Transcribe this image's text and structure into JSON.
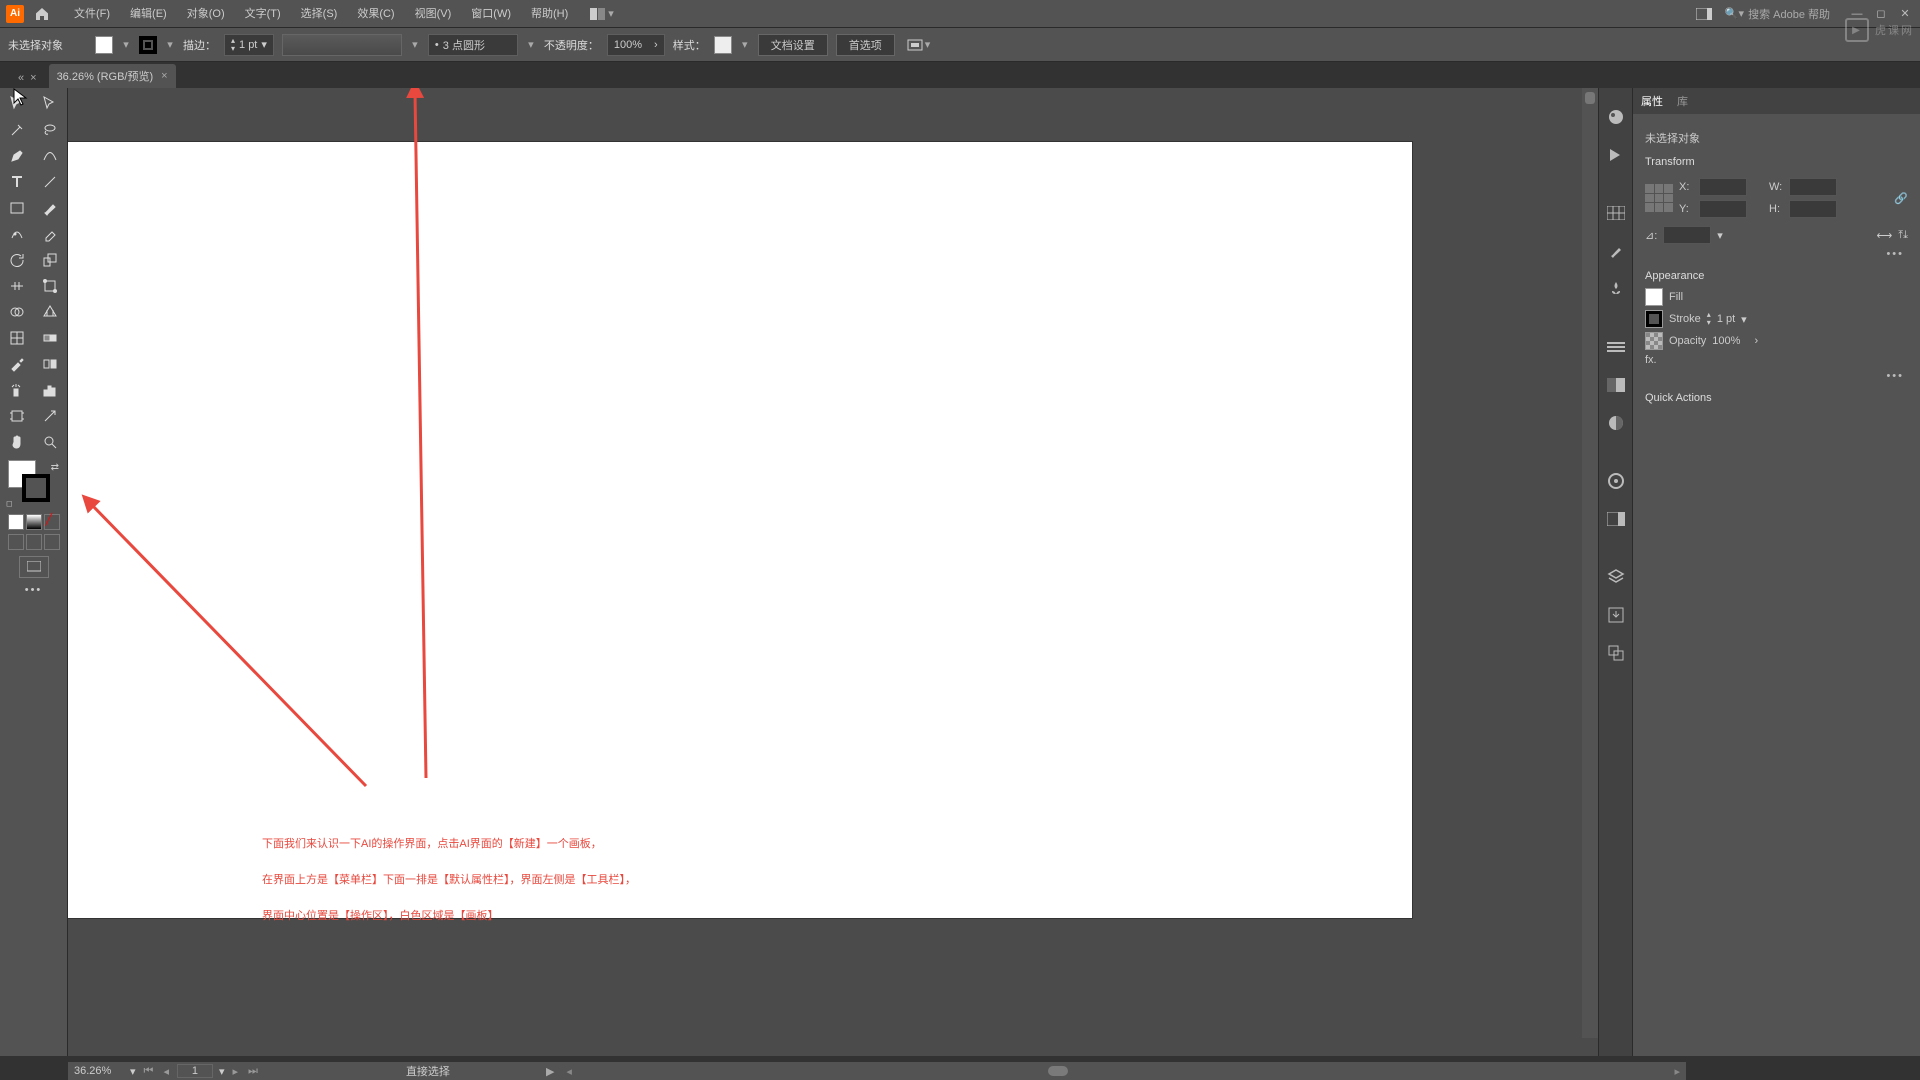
{
  "menu": {
    "items": [
      "文件(F)",
      "编辑(E)",
      "对象(O)",
      "文字(T)",
      "选择(S)",
      "效果(C)",
      "视图(V)",
      "窗口(W)",
      "帮助(H)"
    ],
    "search_placeholder": "搜索 Adobe 帮助"
  },
  "propbar": {
    "no_selection": "未选择对象",
    "stroke_label": "描边：",
    "stroke_value": "1 pt",
    "brush_value": "3 点圆形",
    "brush_bullet": "•",
    "opacity_label": "不透明度：",
    "opacity_value": "100%",
    "style_label": "样式：",
    "doc_setup": "文档设置",
    "prefs": "首选项"
  },
  "tab": {
    "title": "36.26% (RGB/预览)",
    "close": "×"
  },
  "status": {
    "zoom": "36.26%",
    "page": "1",
    "tool": "直接选择"
  },
  "rightpanel": {
    "tabs": [
      "属性",
      "库"
    ],
    "no_selection": "未选择对象",
    "transform_label": "Transform",
    "x_label": "X:",
    "y_label": "Y:",
    "w_label": "W:",
    "h_label": "H:",
    "x_val": "",
    "y_val": "",
    "w_val": "",
    "h_val": "",
    "angle_label": "⊿:",
    "angle_val": "",
    "appearance_label": "Appearance",
    "fill_label": "Fill",
    "stroke_label": "Stroke",
    "stroke_val": "1 pt",
    "opacity_label": "Opacity",
    "opacity_val": "100%",
    "fx_label": "fx.",
    "quick_actions": "Quick Actions"
  },
  "annotation": {
    "line1": "下面我们来认识一下AI的操作界面，点击AI界面的【新建】一个画板，",
    "line2": "在界面上方是【菜单栏】下面一排是【默认属性栏】，界面左侧是【工具栏】，",
    "line3": "界面中心位置是【操作区】，白色区域是【画板】"
  },
  "watermark": "虎课网"
}
